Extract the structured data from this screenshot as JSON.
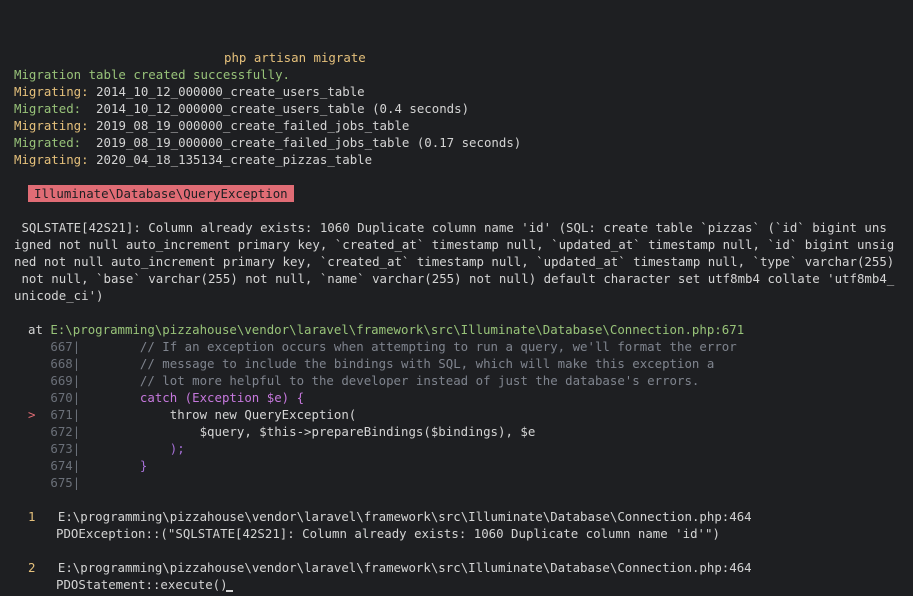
{
  "command": "php artisan migrate",
  "migration_table_msg": "Migration table created successfully.",
  "log": [
    {
      "label": "Migrating:",
      "text": " 2014_10_12_000000_create_users_table",
      "kind": "migrating"
    },
    {
      "label": "Migrated:",
      "text": "  2014_10_12_000000_create_users_table (0.4 seconds)",
      "kind": "migrated"
    },
    {
      "label": "Migrating:",
      "text": " 2019_08_19_000000_create_failed_jobs_table",
      "kind": "migrating"
    },
    {
      "label": "Migrated:",
      "text": "  2019_08_19_000000_create_failed_jobs_table (0.17 seconds)",
      "kind": "migrated"
    },
    {
      "label": "Migrating:",
      "text": " 2020_04_18_135134_create_pizzas_table",
      "kind": "migrating"
    }
  ],
  "exception_badge": "Illuminate\\Database\\QueryException",
  "error_lines": [
    " SQLSTATE[42S21]: Column already exists: 1060 Duplicate column name 'id' (SQL: create table `pizzas` (`id` bigint uns",
    "igned not null auto_increment primary key, `created_at` timestamp null, `updated_at` timestamp null, `id` bigint unsig",
    "ned not null auto_increment primary key, `created_at` timestamp null, `updated_at` timestamp null, `type` varchar(255)",
    " not null, `base` varchar(255) not null, `name` varchar(255) not null) default character set utf8mb4 collate 'utf8mb4_",
    "unicode_ci')"
  ],
  "at_label": "at",
  "at_path": "E:\\programming\\pizzahouse\\vendor\\laravel\\framework\\src\\Illuminate\\Database\\Connection.php:671",
  "code_lines": [
    {
      "num": "667|",
      "marker": "",
      "code": "        // If an exception occurs when attempting to run a query, we'll format the error"
    },
    {
      "num": "668|",
      "marker": "",
      "code": "        // message to include the bindings with SQL, which will make this exception a"
    },
    {
      "num": "669|",
      "marker": "",
      "code": "        // lot more helpful to the developer instead of just the database's errors."
    },
    {
      "num": "670|",
      "marker": "",
      "code": "        catch (Exception $e) {"
    },
    {
      "num": "671|",
      "marker": ">",
      "code": "            throw new QueryException("
    },
    {
      "num": "672|",
      "marker": "",
      "code": "                $query, $this->prepareBindings($bindings), $e"
    },
    {
      "num": "673|",
      "marker": "",
      "code": "            );"
    },
    {
      "num": "674|",
      "marker": "",
      "code": "        }"
    },
    {
      "num": "675|",
      "marker": "",
      "code": ""
    }
  ],
  "trace": [
    {
      "index": "1",
      "path": "E:\\programming\\pizzahouse\\vendor\\laravel\\framework\\src\\Illuminate\\Database\\Connection.php:464",
      "call": "PDOException::(\"SQLSTATE[42S21]: Column already exists: 1060 Duplicate column name 'id'\")"
    },
    {
      "index": "2",
      "path": "E:\\programming\\pizzahouse\\vendor\\laravel\\framework\\src\\Illuminate\\Database\\Connection.php:464",
      "call": "PDOStatement::execute()"
    }
  ],
  "colors": {
    "yellow": "#e5c07b",
    "green": "#98c379",
    "badge": "#e06c75",
    "background": "#1e1f22"
  }
}
